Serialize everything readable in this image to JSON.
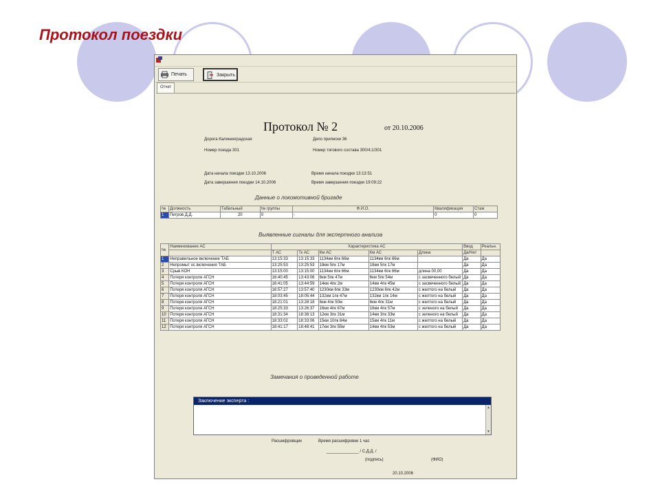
{
  "slide": {
    "title": "Протокол поездки"
  },
  "toolbar": {
    "print_label": "Печать",
    "close_label": "Закрыть"
  },
  "tabs": [
    {
      "label": "Отчет"
    }
  ],
  "report": {
    "title": "Протокол № 2",
    "date": "от 20.10.2006",
    "road": "Дорога Калининградская",
    "depot": "Депо приписки 36",
    "train_no": "Номер поезда 301",
    "consist": "Номер тягового состава 300/4;1/301",
    "start_date": "Дата начала поездки 13.10.2006",
    "start_time": "Время начала поездки 13:13:51",
    "end_date": "Дата завершения поездки 14.10.2006",
    "end_time": "Время завершения поездки 19:09:22",
    "crew_title": "Данные о локомотивной бригаде",
    "signals_title": "Выявленные сигналы для экспертного анализа",
    "files_title": "Замечания о проведенной работе",
    "expert_label": "Заключение эксперта :",
    "footer_decoded": "Расшифровщик",
    "footer_time": "Время расшифровки 1 час",
    "footer_sign_line": "______________ / С.Д.Д. /",
    "footer_sign": "(подпись)",
    "footer_fio": "(ФИО)",
    "footer_date": "20.10.2006"
  },
  "crew_table": {
    "headers": [
      "№",
      "Должность",
      "Табельный",
      "№ группы",
      "Ф.И.О.",
      "Квалификация",
      "Стаж"
    ],
    "rows": [
      [
        "1",
        "Петров Д.Д.",
        "20",
        "0",
        "-",
        "0",
        "0"
      ]
    ]
  },
  "signals_table": {
    "group_headers": {
      "name": "Наименование АС",
      "chars": "Характеристика АС",
      "yes": "Ввод",
      "real": "Реальн."
    },
    "sub_headers": [
      "№",
      "",
      "Т АС",
      "Тк АС",
      "Км АС",
      "Км АС",
      "Длина",
      "Да/Нет",
      ""
    ],
    "rows": [
      [
        "1",
        "Неправильное включение ТАБ",
        "13:15:33",
        "13:15:33",
        "1134км 6пк 66м",
        "1134км 6пк 66м",
        "",
        "Да",
        "Да"
      ],
      [
        "2",
        "Непромыт ос включения ТАБ",
        "13:25:53",
        "13:25:53",
        "18км 5пк 17м",
        "18км 5пк 17м",
        "",
        "Да",
        "Да"
      ],
      [
        "3",
        "Срыв КОН",
        "13:15:00",
        "13:15:00",
        "1134км 6пк 66м",
        "1134км 6пк 66м",
        "длина 00,00",
        "Да",
        "Да"
      ],
      [
        "4",
        "Потеря контроля АГСН",
        "16:40:45",
        "13:43:06",
        "6км 5пк 47м",
        "6км 5пк 54м",
        "с засвеченного белый",
        "Да",
        "Да"
      ],
      [
        "5",
        "Потеря контроля АГСН",
        "16:41:05",
        "13:44:59",
        "14км 4пк 2м",
        "14км 4пк 45м",
        "с засвеченного белый",
        "Да",
        "Да"
      ],
      [
        "6",
        "Потеря контроля АГСН",
        "16:57:27",
        "13:57:40",
        "1230км 6пк 33м",
        "1230км 6пк 42м",
        "с желтого на белый",
        "Да",
        "Да"
      ],
      [
        "7",
        "Потеря контроля АГСН",
        "18:03:45",
        "18:05:44",
        "132км 1пк 47м",
        "132км 1пк 14м",
        "с желтого на белый",
        "Да",
        "Да"
      ],
      [
        "8",
        "Потеря контроля АГСН",
        "18:21:01",
        "13:28:18",
        "6км 4пк 50м",
        "6км 4пк 31м",
        "с желтого на белый",
        "Да",
        "Да"
      ],
      [
        "9",
        "Потеря контроля АГСН",
        "18:25:33",
        "13:26:37",
        "16км 4пк 67м",
        "16км 4пк 57м",
        "с зеленого на белый",
        "Да",
        "Да"
      ],
      [
        "10",
        "Потеря контроля АГСН",
        "18:31:34",
        "18:38:13",
        "12км 3пк 31м",
        "14км 3пк 33м",
        "с зеленого на белый",
        "Да",
        "Да"
      ],
      [
        "11",
        "Потеря контроля АГСН",
        "18:33:02",
        "18:33:06",
        "15км 10пк 84м",
        "15км 4пк 11м",
        "с желтого на белый",
        "Да",
        "Да"
      ],
      [
        "12",
        "Потеря контроля АГСН",
        "18:41:17",
        "18:48:41",
        "17км 3пк 55м",
        "14км 4пк 53м",
        "с желтого на белый",
        "Да",
        "Да"
      ]
    ]
  },
  "colors": {
    "title": "#a8131b",
    "circle": "#c9c9ec",
    "expert_header": "#0a246a",
    "selection": "#2a4ba8"
  }
}
